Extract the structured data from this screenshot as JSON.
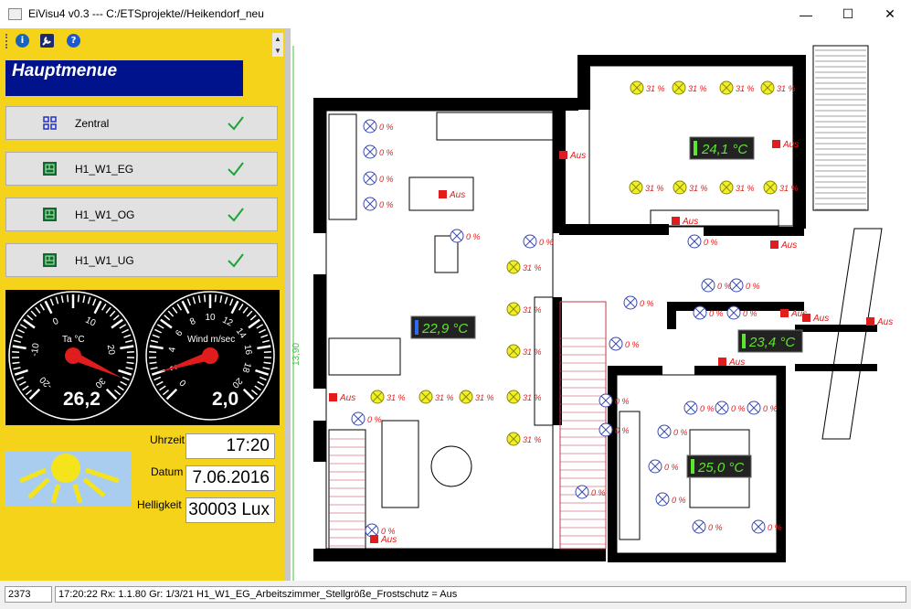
{
  "window": {
    "title": "EiVisu4 v0.3 --- C:/ETSprojekte//Heikendorf_neu",
    "minimize": "—",
    "maximize": "☐",
    "close": "✕"
  },
  "toolbar": {
    "info": "i",
    "settings": "🔧",
    "help": "?"
  },
  "menu": {
    "header": "Hauptmenue",
    "items": [
      {
        "label": "Zentral",
        "icon": "grid-icon"
      },
      {
        "label": "H1_W1_EG",
        "icon": "floorplan-icon"
      },
      {
        "label": "H1_W1_OG",
        "icon": "floorplan-icon"
      },
      {
        "label": "H1_W1_UG",
        "icon": "floorplan-icon"
      }
    ]
  },
  "gauges": {
    "temperature": {
      "label": "Ta °C",
      "value": "26,2",
      "value_num": 26.2,
      "ticks": [
        "-20",
        "-10",
        "0",
        "10",
        "20",
        "30"
      ],
      "tick_values": [
        -20,
        -10,
        0,
        10,
        20,
        30
      ],
      "min": -20,
      "max": 30
    },
    "wind": {
      "label": "Wind m/sec",
      "value": "2,0",
      "value_num": 2.0,
      "ticks": [
        "0",
        "2",
        "4",
        "6",
        "8",
        "10",
        "12",
        "14",
        "16",
        "18",
        "20"
      ],
      "tick_values": [
        0,
        2,
        4,
        6,
        8,
        10,
        12,
        14,
        16,
        18,
        20
      ],
      "min": 0,
      "max": 20
    }
  },
  "info": {
    "time_label": "Uhrzeit",
    "time": "17:20",
    "date_label": "Datum",
    "date": "7.06.2016",
    "brightness_label": "Helligkeit",
    "brightness": "30003 Lux"
  },
  "plan": {
    "dimension": "13,90",
    "thermostats": [
      "24,1 °C",
      "22,9 °C",
      "23,4 °C",
      "25,0 °C"
    ],
    "aus": "Aus",
    "pct_0": "0 %",
    "pct_31": "31 %"
  },
  "status": {
    "count": "2373",
    "message": "17:20:22 Rx: 1.1.80   Gr: 1/3/21   H1_W1_EG_Arbeitszimmer_Stellgröße_Frostschutz = Aus"
  },
  "colors": {
    "sidebar": "#f5d31a",
    "header": "#00128c",
    "red": "#e01c1c",
    "lamp_on": "#f1ef2b",
    "thermo_text": "#5ee52e"
  }
}
